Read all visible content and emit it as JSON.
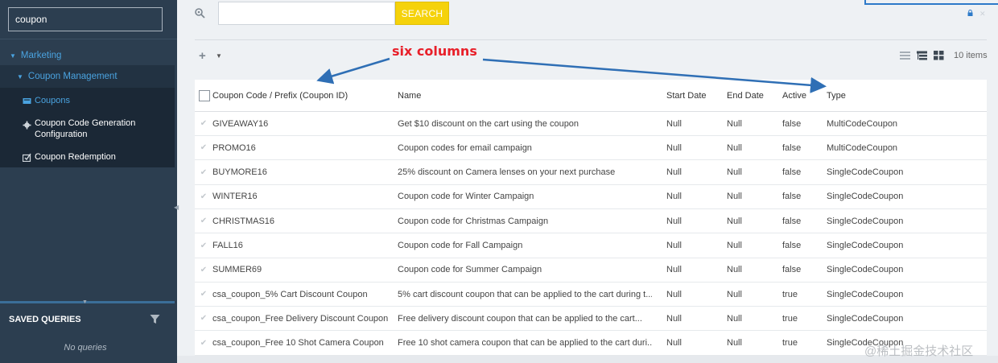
{
  "sidebar": {
    "search_value": "coupon",
    "tree": {
      "marketing": "Marketing",
      "coupon_management": "Coupon Management",
      "items": [
        {
          "label": "Coupons",
          "icon": "coupon-icon"
        },
        {
          "label": "Coupon Code Generation Configuration",
          "icon": "gear-icon"
        },
        {
          "label": "Coupon Redemption",
          "icon": "redemption-icon"
        }
      ]
    },
    "saved_queries": {
      "title": "SAVED QUERIES",
      "empty_text": "No queries"
    }
  },
  "toolbar": {
    "search_placeholder": "",
    "search_button": "SEARCH",
    "add_icon": "plus-icon",
    "item_count": "10 items"
  },
  "annotation": {
    "text": "six columns",
    "color": "#e8202a"
  },
  "table": {
    "columns": [
      "Coupon Code / Prefix (Coupon ID)",
      "Name",
      "Start Date",
      "End Date",
      "Active",
      "Type"
    ],
    "rows": [
      {
        "code": "GIVEAWAY16",
        "name": "Get $10 discount on the cart using the coupon",
        "start": "Null",
        "end": "Null",
        "active": "false",
        "type": "MultiCodeCoupon"
      },
      {
        "code": "PROMO16",
        "name": "Coupon codes for email campaign",
        "start": "Null",
        "end": "Null",
        "active": "false",
        "type": "MultiCodeCoupon"
      },
      {
        "code": "BUYMORE16",
        "name": "25% discount on Camera lenses on your next purchase",
        "start": "Null",
        "end": "Null",
        "active": "false",
        "type": "SingleCodeCoupon"
      },
      {
        "code": "WINTER16",
        "name": "Coupon code for Winter Campaign",
        "start": "Null",
        "end": "Null",
        "active": "false",
        "type": "SingleCodeCoupon"
      },
      {
        "code": "CHRISTMAS16",
        "name": "Coupon code for Christmas Campaign",
        "start": "Null",
        "end": "Null",
        "active": "false",
        "type": "SingleCodeCoupon"
      },
      {
        "code": "FALL16",
        "name": "Coupon code for Fall Campaign",
        "start": "Null",
        "end": "Null",
        "active": "false",
        "type": "SingleCodeCoupon"
      },
      {
        "code": "SUMMER69",
        "name": "Coupon code for Summer Campaign",
        "start": "Null",
        "end": "Null",
        "active": "false",
        "type": "SingleCodeCoupon"
      },
      {
        "code": "csa_coupon_5% Cart Discount Coupon",
        "name": "5% cart discount coupon that can be applied to the cart during t...",
        "start": "Null",
        "end": "Null",
        "active": "true",
        "type": "SingleCodeCoupon"
      },
      {
        "code": "csa_coupon_Free Delivery Discount Coupon",
        "name": "Free delivery discount coupon that can be applied to the cart...",
        "start": "Null",
        "end": "Null",
        "active": "true",
        "type": "SingleCodeCoupon"
      },
      {
        "code": "csa_coupon_Free 10 Shot Camera Coupon",
        "name": "Free 10 shot camera coupon that can be applied to the cart duri...",
        "start": "Null",
        "end": "Null",
        "active": "true",
        "type": "SingleCodeCoupon"
      }
    ]
  },
  "watermark": "@稀土掘金技术社区",
  "colors": {
    "sidebar_bg": "#2c3e50",
    "accent": "#4aa3e0",
    "search_button": "#f5d20b"
  }
}
